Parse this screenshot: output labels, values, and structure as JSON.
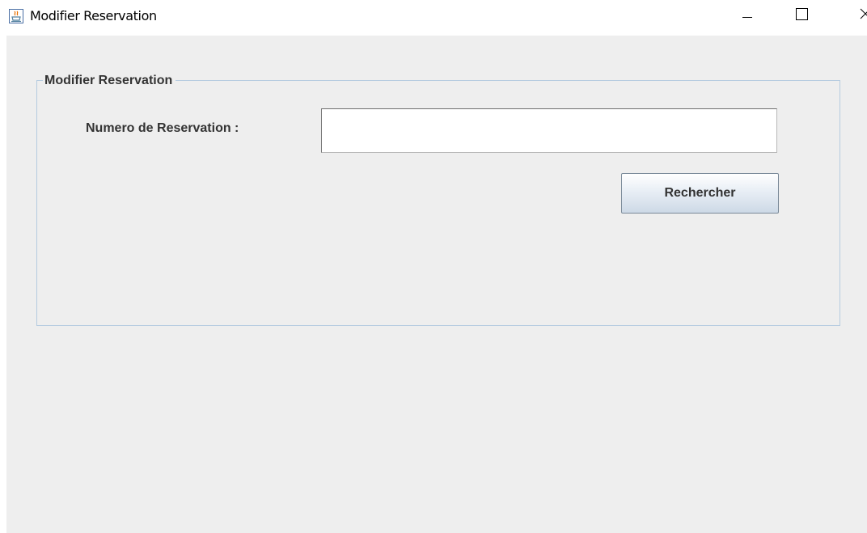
{
  "window": {
    "title": "Modifier Reservation",
    "icon": "java-cup-icon",
    "controls": {
      "minimize": "minimize-icon",
      "maximize": "maximize-icon",
      "close": "close-icon"
    }
  },
  "form": {
    "group_title": "Modifier Reservation",
    "reservation_number_label": "Numero de Reservation :",
    "reservation_number_value": "",
    "search_button_label": "Rechercher"
  },
  "colors": {
    "content_background": "#eeeeee",
    "group_border": "#b5cbe0",
    "label_text": "#333333"
  }
}
